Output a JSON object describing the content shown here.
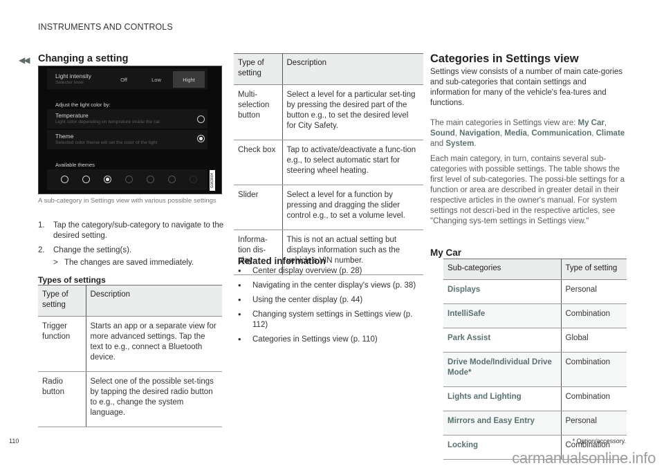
{
  "header": {
    "running_head": "INSTRUMENTS AND CONTROLS",
    "back_icon": "double-chevron-left-icon"
  },
  "section1": {
    "title": "Changing a setting",
    "screen": {
      "light_intensity_label": "Light intensity",
      "light_intensity_sub": "Selecter level",
      "segments": [
        "Off",
        "Low",
        "Hight"
      ],
      "active_segment": "Hight",
      "adjust_label": "Adjust the light color by:",
      "temperature_label": "Temperature",
      "temperature_sub": "Light color depending on temprature inside the car",
      "temperature_selected": false,
      "theme_label": "Theme",
      "theme_sub": "Selected color theme will set the color of the light",
      "theme_selected": true,
      "available_themes_label": "Available themes",
      "theme_count": 7,
      "selected_theme_index": 2,
      "image_id": "G063604"
    },
    "caption": "A sub-category in Settings view with various possible settings",
    "steps": [
      {
        "num": "1.",
        "text": "Tap the category/sub-category to navigate to the desired setting."
      },
      {
        "num": "2.",
        "text": "Change the setting(s).",
        "result_marker": ">",
        "result": "The changes are saved immediately."
      }
    ]
  },
  "types_of_settings": {
    "title": "Types of settings",
    "headers": [
      "Type of setting",
      "Description"
    ],
    "rows": [
      {
        "type": "Trigger function",
        "desc": "Starts an app or a separate view for more advanced settings. Tap the text to e.g., connect a Bluetooth device."
      },
      {
        "type": "Radio button",
        "desc": "Select one of the possible set-tings by tapping the desired radio button to e.g., change the system language."
      }
    ],
    "continued_headers": [
      "Type of setting",
      "Description"
    ],
    "continued_rows": [
      {
        "type": "Multi-selection button",
        "desc": "Select a level for a particular set-ting by pressing the desired part of the button e.g., to set the desired level for City Safety."
      },
      {
        "type": "Check box",
        "desc": "Tap to activate/deactivate a func-tion e.g., to select automatic start for steering wheel heating."
      },
      {
        "type": "Slider",
        "desc": "Select a level for a function by pressing and dragging the slider control e.g., to set a volume level."
      },
      {
        "type": "Informa-tion dis-play",
        "desc": "This is not an actual setting but displays information such as the vehicle's VIN number."
      }
    ]
  },
  "related": {
    "title": "Related information",
    "items": [
      "Center display overview (p. 28)",
      "Navigating in the center display's views (p. 38)",
      "Using the center display (p. 44)",
      "Changing system settings in Settings view (p. 112)",
      "Categories in Settings view (p. 110)"
    ]
  },
  "section2": {
    "title": "Categories in Settings view",
    "intro": "Settings view consists of a number of main cate-gories and sub-categories that contain settings and information for many of the vehicle's fea-tures and functions.",
    "main_categories_lead": "The main categories in Settings view are: ",
    "main_categories": [
      "My Car",
      "Sound",
      "Navigation",
      "Media",
      "Communication",
      "Climate",
      "System"
    ],
    "and_word": "and",
    "body": "Each main category, in turn, contains several sub-categories with possible settings. The table shows the first level of sub-categories. The possi-ble settings for a function or area are described in greater detail in their respective articles in the owner's manual. For system settings not descri-bed in the respective articles, see \"Changing sys-tem settings in Settings view.\"",
    "my_car": {
      "title": "My Car",
      "headers": [
        "Sub-categories",
        "Type of setting"
      ],
      "rows": [
        {
          "sub": "Displays",
          "type": "Personal"
        },
        {
          "sub": "IntelliSafe",
          "type": "Combination"
        },
        {
          "sub": "Park Assist",
          "type": "Global"
        },
        {
          "sub": "Drive Mode/Individual Drive Mode*",
          "type": "Combination"
        },
        {
          "sub": "Lights and Lighting",
          "type": "Combination"
        },
        {
          "sub": "Mirrors and Easy Entry",
          "type": "Personal"
        },
        {
          "sub": "Locking",
          "type": "Combination"
        }
      ]
    }
  },
  "footer": {
    "page_number": "110",
    "footnote": "* Option/accessory.",
    "watermark": "carmanualsonline.info"
  },
  "colors": {
    "keyword": "#5b7070",
    "table_header_bg": "#ebecec",
    "screen_bg": "#0b0b0b"
  }
}
